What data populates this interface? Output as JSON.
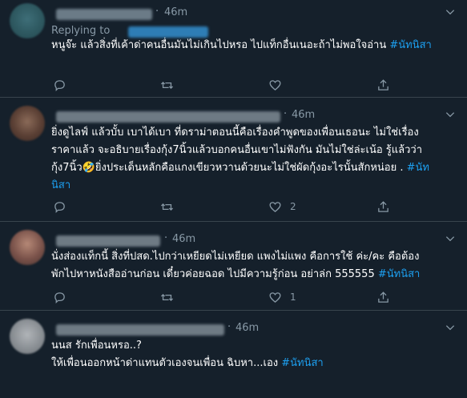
{
  "colors": {
    "background": "#15202b",
    "text": "#ffffff",
    "muted": "#8899a6",
    "accent": "#1da1f2",
    "divider": "#38444d"
  },
  "tweets": [
    {
      "time": "46m",
      "replying_to": "Replying to",
      "text": "หนูจ๊ะ แล้วสิ่งที่เค้าด่าคนอื่นมันไม่เกินไปหรอ ไปแท็กอื่นเนอะถ้าไม่พอใจอ่าน ",
      "hashtag": "#นัทนิสา",
      "reply_count": "",
      "retweet_count": "",
      "like_count": ""
    },
    {
      "time": "46m",
      "line1": "ยิ่งดูไลฟ์ แล้วบั้บ เบาได้เบา ที่ดราม่าตอนนี้คือเรื่องคำพูดของเพื่อนเธอนะ ไม่ใช่เรื่อง",
      "line2": "ราคาแล้ว จะอธิบายเรื่องกุ้ง7นิ้วแล้วบอกคนอื่นเขาไม่ฟังกัน มันไม่ใช่ล่ะเน้อ รู้แล้วว่า",
      "line3": "กุ้ง7นิ้ว",
      "emoji": "🤣",
      "line3b": "ยิ่งประเด็นหลักคือแกงเขียวหวานด้วยนะไม่ใช่ผัดกุ้งอะไรนั้นสักหน่อย . ",
      "hashtag_a": "#นัท",
      "hashtag_b": "นิสา",
      "reply_count": "",
      "retweet_count": "",
      "like_count": "2"
    },
    {
      "time": "46m",
      "line1": "นั่งส่องแท็กนี้ สิ่งที่ปสด.ไปกว่าเหยียดไม่เหยียด แพงไม่แพง คือการใช้ ค่ะ/คะ คือต้อง",
      "line2": "พักไปหาหนังสืออ่านก่อน เดี๋ยวค่อยฉอด ไปมีความรู้ก่อน อย่าล่ก 555555 ",
      "hashtag": "#นัทนิสา",
      "reply_count": "",
      "retweet_count": "",
      "like_count": "1"
    },
    {
      "time": "46m",
      "line1": "นนส รักเพื่อนหรอ..?",
      "line2": "ให้เพื่อนออกหน้าด่าแทนตัวเองจนเพื่อน ฉิบหา...เอง ",
      "hashtag": "#นัทนิสา"
    }
  ]
}
